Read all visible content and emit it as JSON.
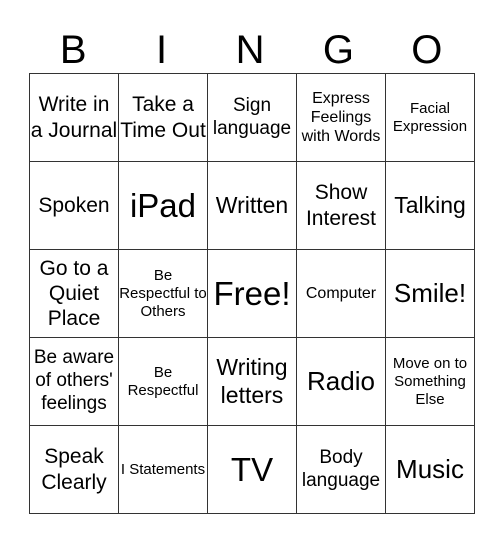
{
  "header": [
    "B",
    "I",
    "N",
    "G",
    "O"
  ],
  "rows": [
    [
      "Write in a Journal",
      "Take a Time Out",
      "Sign language",
      "Express Feelings with Words",
      "Facial Expression"
    ],
    [
      "Spoken",
      "iPad",
      "Written",
      "Show Interest",
      "Talking"
    ],
    [
      "Go to a Quiet Place",
      "Be Respectful to Others",
      "Free!",
      "Computer",
      "Smile!"
    ],
    [
      "Be aware of others' feelings",
      "Be Respectful",
      "Writing letters",
      "Radio",
      "Move on to Something Else"
    ],
    [
      "Speak Clearly",
      "I Statements",
      "TV",
      "Body language",
      "Music"
    ]
  ]
}
